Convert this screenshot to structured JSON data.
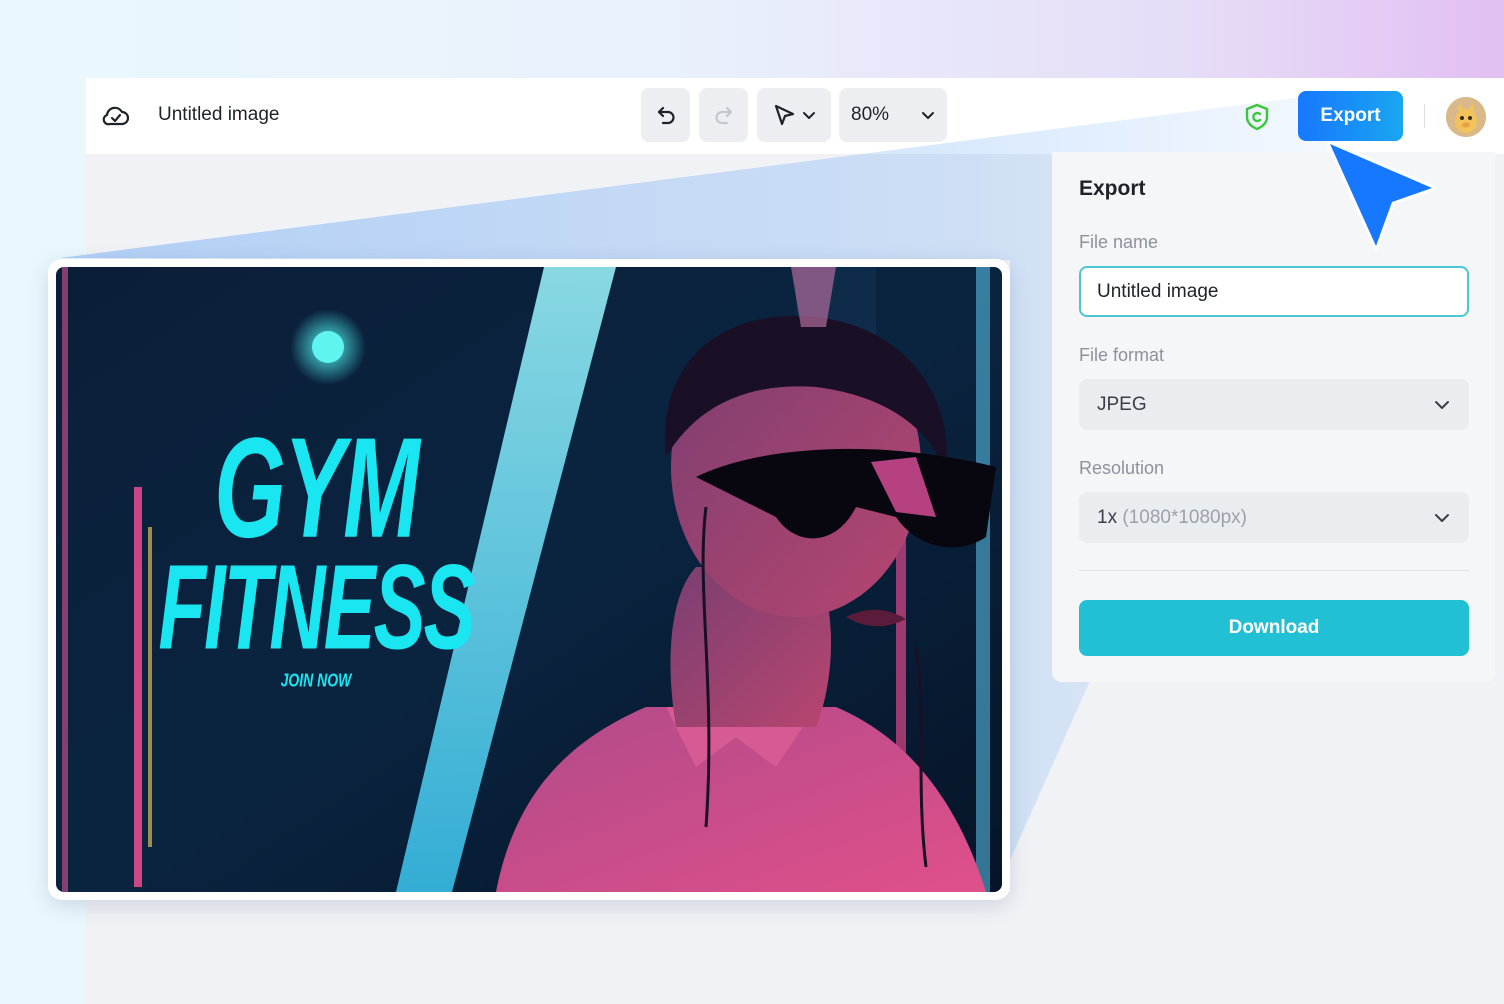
{
  "header": {
    "doc_title": "Untitled image",
    "zoom": "80%",
    "export_label": "Export"
  },
  "export_panel": {
    "title": "Export",
    "file_name_label": "File name",
    "file_name_value": "Untitled image",
    "file_format_label": "File format",
    "file_format_value": "JPEG",
    "resolution_label": "Resolution",
    "resolution_scale": "1x",
    "resolution_size": "(1080*1080px)",
    "download_label": "Download"
  },
  "canvas": {
    "headline_line1": "GYM",
    "headline_line2": "FITNESS",
    "cta": "JOIN NOW"
  },
  "colors": {
    "accent": "#1677ff",
    "download": "#22c0d4",
    "input_border": "#4dc6d4",
    "headline": "#19e6f0",
    "shield": "#3ccc2c"
  },
  "icons": [
    "cloud-icon",
    "undo-icon",
    "redo-icon",
    "pointer-icon",
    "chevron-down-icon",
    "shield-icon",
    "avatar",
    "cursor-icon"
  ]
}
